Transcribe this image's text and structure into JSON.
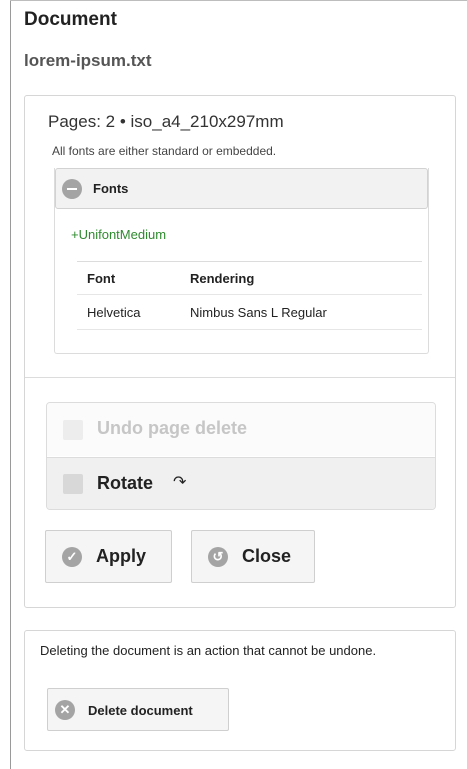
{
  "header": {
    "title": "Document",
    "file_name": "lorem-ipsum.txt"
  },
  "info": {
    "pages_line": "Pages: 2 • iso_a4_210x297mm",
    "fonts_note": "All fonts are either standard or embedded."
  },
  "fonts": {
    "header_label": "Fonts",
    "header_icon": "minus-circle-icon",
    "embedded_font": "+UnifontMedium",
    "table": {
      "columns": [
        "Font",
        "Rendering"
      ],
      "rows": [
        [
          "Helvetica",
          "Nimbus Sans L Regular"
        ]
      ]
    }
  },
  "actions": {
    "undo_label": "Undo page delete",
    "undo_checked": false,
    "undo_disabled": true,
    "rotate_label": "Rotate",
    "rotate_icon_glyph": "↷",
    "rotate_checked": false
  },
  "buttons": {
    "apply_label": "Apply",
    "apply_icon": "check-circle-icon",
    "close_label": "Close",
    "close_icon": "undo-circle-icon"
  },
  "delete_section": {
    "note": "Deleting the document is an action that cannot be undone.",
    "button_label": "Delete document",
    "button_icon": "x-circle-icon"
  },
  "colors": {
    "icon_grey": "#a4a4a4",
    "embedded_font_green": "#2f8a2f",
    "disabled_text": "#c6c6c6"
  }
}
